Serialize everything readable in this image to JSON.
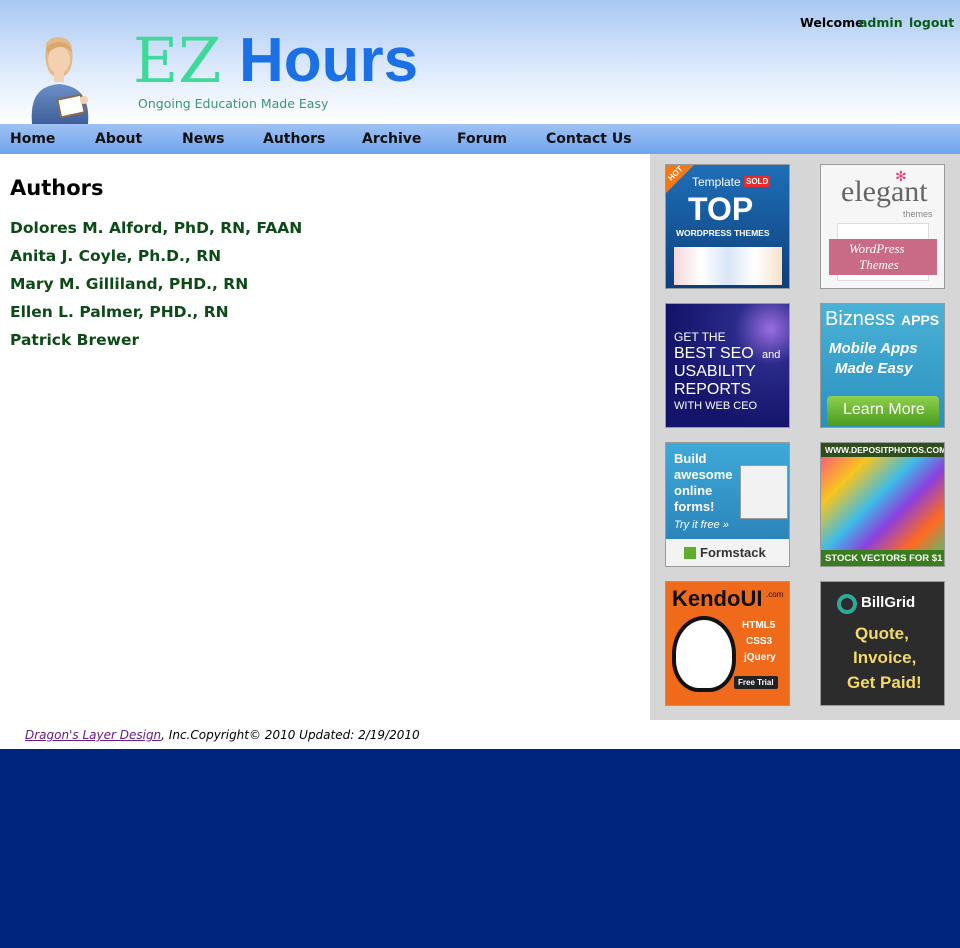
{
  "header": {
    "logo_ez": "EZ",
    "logo_hours": "Hours",
    "tagline": "Ongoing Education Made Easy",
    "welcome_label": "Welcome",
    "username": "admin",
    "logout_label": "logout"
  },
  "nav": {
    "items": [
      "Home",
      "About",
      "News",
      "Authors",
      "Archive",
      "Forum",
      "Contact Us"
    ]
  },
  "main": {
    "title": "Authors",
    "authors": [
      "Dolores M. Alford, PhD, RN, FAAN",
      "Anita J. Coyle, Ph.D., RN",
      "Mary M. Gilliland, PHD., RN",
      "Ellen L. Palmer, PHD., RN",
      "Patrick Brewer"
    ]
  },
  "ads": {
    "a1": {
      "badge": "HOT",
      "brand": "Template",
      "sold": "SOLD",
      "big": "TOP",
      "sub": "WORDPRESS THEMES"
    },
    "a2": {
      "brand": "elegant",
      "sub": "themes",
      "ribbon1": "WordPress",
      "ribbon2": "Themes"
    },
    "a3": {
      "l1": "GET THE",
      "l2": "BEST SEO",
      "l2b": "and",
      "l3": "USABILITY",
      "l4": "REPORTS",
      "l5": "WITH WEB CEO"
    },
    "a4": {
      "brand1": "Bizness",
      "brand2": "APPS",
      "t1": "Mobile Apps",
      "t2": "Made Easy",
      "cta": "Learn More"
    },
    "a5": {
      "l1": "Build",
      "l2": "awesome",
      "l3": "online",
      "l4": "forms!",
      "l5": "Try it free »",
      "brand": "Formstack"
    },
    "a6": {
      "top": "WWW.DEPOSITPHOTOS.COM",
      "bottom": "STOCK VECTORS FOR $1"
    },
    "a7": {
      "brand": "KendoUI",
      "dotcom": ".com",
      "t1": "HTML5",
      "t2": "CSS3",
      "t3": "jQuery",
      "cta": "Free Trial"
    },
    "a8": {
      "brand": "BillGrid",
      "t1": "Quote,",
      "t2": "Invoice,",
      "t3": "Get Paid!"
    }
  },
  "footer": {
    "link": "Dragon's Layer Design",
    "rest": ", Inc.Copyright© 2010 Updated: 2/19/2010"
  },
  "colors": {
    "page_bg": "#00257e",
    "nav_bg": "#7aaaf0",
    "author_link": "#0c4a16",
    "logo_ez": "#3fd99a",
    "logo_hours": "#1b70e6"
  }
}
